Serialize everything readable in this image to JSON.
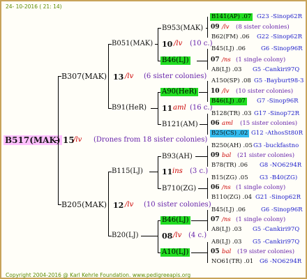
{
  "header": {
    "date": "24- 10-2016 ( 21: 14)"
  },
  "footer": {
    "copyright": "Copyright 2004-2016 @ Karl Kehrle Foundation.   www.pedigreeapis.org"
  },
  "root": {
    "name": "B517(MAK)",
    "num": "15",
    "suffix": "/lv",
    "note": "(Drones from 18 sister colonies)"
  },
  "sire": {
    "name": "B307(MAK)",
    "num": "13",
    "suffix": "/lv",
    "note": "(6 sister colonies)"
  },
  "dam": {
    "name": "B205(MAK)",
    "num": "12",
    "suffix": "/lv",
    "note": "(10 sister colonies)"
  },
  "gen3": [
    {
      "name": "B051(MAK)"
    },
    {
      "name": "B91(HeR)"
    },
    {
      "name": "B115(LJ)"
    },
    {
      "name": "B20(LJ)"
    }
  ],
  "gen4": [
    {
      "name": "B953(MAK)",
      "num": "10",
      "suffix": "/lv",
      "note": "(10 c.)"
    },
    {
      "name": "B46(LJ)"
    },
    {
      "name": "A90(HeR)",
      "num": "11",
      "suffix": "aml",
      "note": "(16 c.)"
    },
    {
      "name": "B121(AM)"
    },
    {
      "name": "B93(AH)",
      "num": "11",
      "suffix": "ins",
      "note": "(3 c.)"
    },
    {
      "name": "B710(ZG)"
    },
    {
      "name": "B46(LJ)",
      "num": "08",
      "suffix": "/lv",
      "note": "(4 c.)"
    },
    {
      "name": "A10(LJ)"
    }
  ],
  "gen5": [
    {
      "l1": "B141(AP) .07",
      "l1r": "G23 -Sinop62R",
      "num": "09",
      "suf": "/lv",
      "note": "(8 sister colonies)",
      "l3": "B62(FM) .06",
      "l3r": "G22 -Sinop62R"
    },
    {
      "l1": "B45(LJ) .06",
      "l1r": "G6 -Sinop96R",
      "num": "07",
      "suf": "/ns",
      "note": "(1 single colony)",
      "l3": "A8(LJ) .03",
      "l3r": "G5 -Cankiri97Q"
    },
    {
      "l1": "A150(SP) .08",
      "l1r": "G5 -Bayburt98-3",
      "num": "10",
      "suf": "/lv",
      "note": "(10 sister colonies)",
      "l3": "B46(LJ) .07",
      "l3r": "G7 -Sinop96R"
    },
    {
      "l1": "B128(TR) .03",
      "l1r": "G17 -Sinop72R",
      "num": "06",
      "suf": "aml",
      "note": "(15 sister colonies)",
      "l3": "B25(CS) .02",
      "l3r": "G12 -AthosSt80R"
    },
    {
      "l1": "B250(AH) .05",
      "l1r": "G3 -buckfastno",
      "num": "09",
      "suf": "bal",
      "note": "(21 sister colonies)",
      "l3": "B78(TR) .06",
      "l3r": "G8 -NO6294R"
    },
    {
      "l1": "B15(ZG) .05",
      "l1r": "G3 -B40(ZG)",
      "num": "06",
      "suf": "/ns",
      "note": "(1 single colony)",
      "l3": "B110(ZG) .04",
      "l3r": "G21 -Sinop62R"
    },
    {
      "l1": "B45(LJ) .06",
      "l1r": "G6 -Sinop96R",
      "num": "07",
      "suf": "/ns",
      "note": "(1 single colony)",
      "l3": "A8(LJ) .03",
      "l3r": "G5 -Cankiri97Q"
    },
    {
      "l1": "A8(LJ) .03",
      "l1r": "G5 -Cankiri97Q",
      "num": "05",
      "suf": "bal",
      "note": "(19 sister colonies)",
      "l3": "NO61(TR) .01",
      "l3r": "G6 -NO6294R"
    }
  ]
}
